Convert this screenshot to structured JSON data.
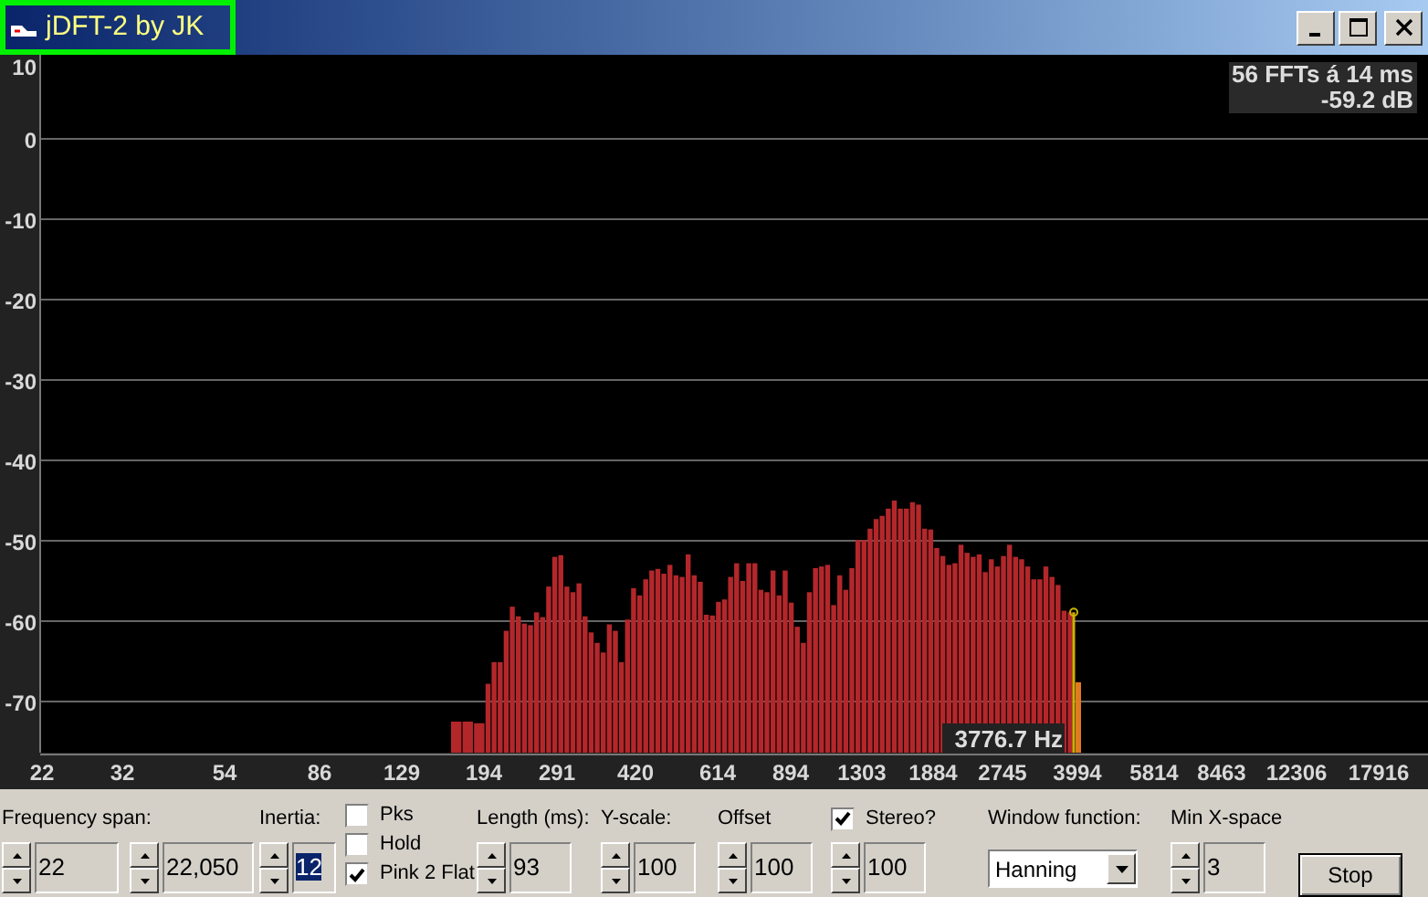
{
  "window": {
    "title": "jDFT-2 by JK"
  },
  "readout": [
    "56 FFTs á 14 ms",
    "-59.2 dB"
  ],
  "spectrum": {
    "y_axis_labels": [
      "10",
      "0",
      "-10",
      "-20",
      "-30",
      "-40",
      "-50",
      "-60",
      "-70"
    ],
    "x_axis_labels": [
      "22",
      "32",
      "54",
      "86",
      "129",
      "194",
      "291",
      "420",
      "614",
      "894",
      "1303",
      "1884",
      "2745",
      "3994",
      "5814",
      "8463",
      "12306",
      "17916"
    ],
    "cursor_label": "3776.7 Hz"
  },
  "panel": [
    {
      "kind": "spin",
      "label": "Frequency span:",
      "fields": [
        {
          "value": "22",
          "selected": false
        },
        {
          "value": "22,050",
          "selected": false
        }
      ]
    },
    {
      "kind": "spin",
      "label": "Inertia:",
      "fields": [
        {
          "value": "12",
          "selected": true
        }
      ]
    },
    {
      "kind": "checks",
      "items": [
        {
          "label": "Pks",
          "checked": false
        },
        {
          "label": "Hold",
          "checked": false
        },
        {
          "label": "Pink 2 Flat",
          "checked": true
        }
      ]
    },
    {
      "kind": "spin",
      "label": "Length (ms):",
      "fields": [
        {
          "value": "93",
          "selected": false
        }
      ]
    },
    {
      "kind": "spin",
      "label": "Y-scale:",
      "fields": [
        {
          "value": "100",
          "selected": false
        }
      ]
    },
    {
      "kind": "spin",
      "label": "Offset",
      "fields": [
        {
          "value": "100",
          "selected": false
        }
      ]
    },
    {
      "kind": "checkspin",
      "label": "Stereo?",
      "checked": true,
      "fields": [
        {
          "value": "100",
          "selected": false
        }
      ]
    },
    {
      "kind": "select",
      "label": "Window function:",
      "value": "Hanning"
    },
    {
      "kind": "spin",
      "label": "Min X-space",
      "fields": [
        {
          "value": "3",
          "selected": false
        }
      ]
    },
    {
      "kind": "button",
      "label": "Stop"
    }
  ]
}
